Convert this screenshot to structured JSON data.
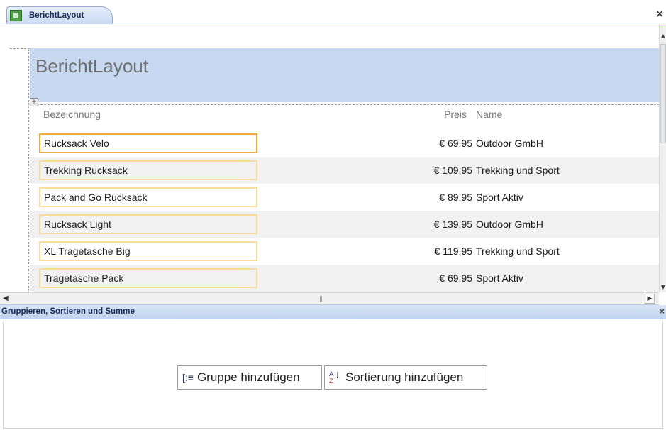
{
  "document_tab": {
    "label": "BerichtLayout",
    "icon": "report-icon"
  },
  "report": {
    "title": "BerichtLayout",
    "columns": {
      "bezeichnung": "Bezeichnung",
      "preis": "Preis",
      "name": "Name"
    },
    "rows": [
      {
        "bezeichnung": "Rucksack Velo",
        "preis": "€ 69,95",
        "name": "Outdoor GmbH"
      },
      {
        "bezeichnung": "Trekking Rucksack",
        "preis": "€ 109,95",
        "name": "Trekking und Sport"
      },
      {
        "bezeichnung": "Pack and Go Rucksack",
        "preis": "€ 89,95",
        "name": "Sport Aktiv"
      },
      {
        "bezeichnung": "Rucksack Light",
        "preis": "€ 139,95",
        "name": "Outdoor GmbH"
      },
      {
        "bezeichnung": "XL Tragetasche Big",
        "preis": "€ 119,95",
        "name": "Trekking und Sport"
      },
      {
        "bezeichnung": "Tragetasche Pack",
        "preis": "€ 69,95",
        "name": "Sport Aktiv"
      }
    ]
  },
  "group_pane": {
    "title": "Gruppieren, Sortieren und Summe",
    "add_group_label": "Gruppe hinzufügen",
    "add_sort_label": "Sortierung hinzufügen"
  },
  "colors": {
    "header_band": "#c6d9f1",
    "selected_border": "#f3a93a",
    "field_border": "#f9dc9b",
    "alt_row": "#f1f1f1"
  }
}
